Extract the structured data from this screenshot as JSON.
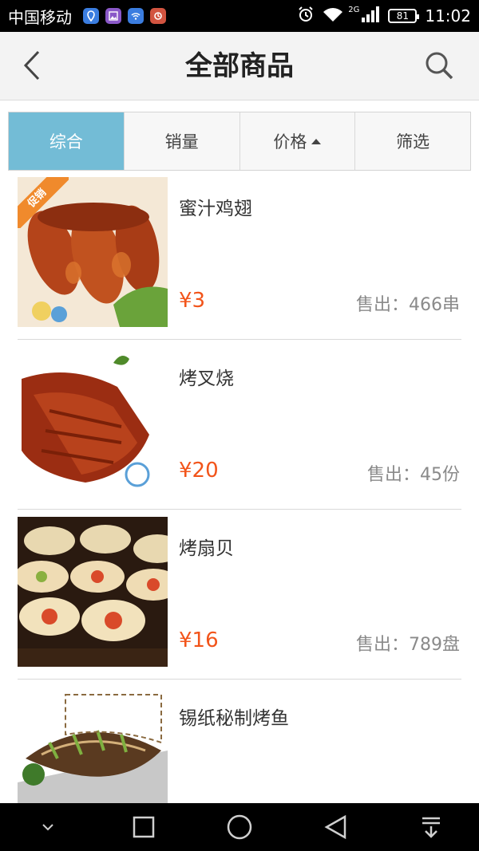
{
  "status_bar": {
    "carrier": "中国移动",
    "network": "2G",
    "battery": "81",
    "time": "11:02"
  },
  "header": {
    "title": "全部商品"
  },
  "tabs": [
    {
      "label": "综合"
    },
    {
      "label": "销量"
    },
    {
      "label": "价格"
    },
    {
      "label": "筛选"
    }
  ],
  "products": [
    {
      "name": "蜜汁鸡翅",
      "price": "¥3",
      "sold": "售出：466串",
      "badge": "促销"
    },
    {
      "name": "烤叉烧",
      "price": "¥20",
      "sold": "售出：45份"
    },
    {
      "name": "烤扇贝",
      "price": "¥16",
      "sold": "售出：789盘"
    },
    {
      "name": "锡纸秘制烤鱼",
      "price": "",
      "sold": ""
    }
  ],
  "colors": {
    "active_tab": "#73bcd6",
    "price": "#f2541a"
  }
}
